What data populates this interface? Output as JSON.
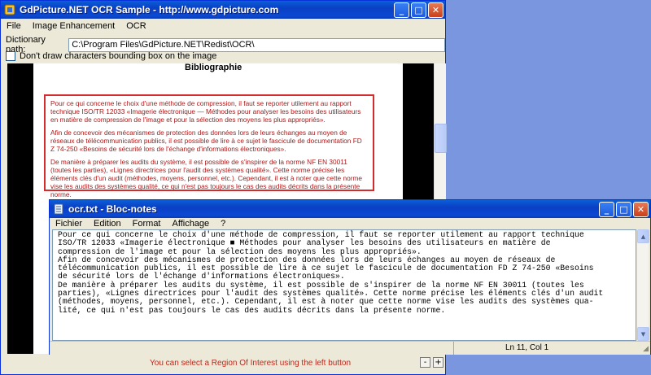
{
  "main_window": {
    "title": "GdPicture.NET OCR Sample  -  http://www.gdpicture.com",
    "menu": [
      "File",
      "Image Enhancement",
      "OCR"
    ],
    "dictionary_label": "Dictionary path:",
    "dictionary_value": "C:\\Program Files\\GdPicture.NET\\Redist\\OCR\\",
    "checkbox_label": "Don't draw characters bounding box on the image",
    "doc_heading": "Bibliographie",
    "doc_paragraphs": [
      "Pour ce qui concerne le choix d'une méthode de compression, il faut se reporter utilement au rapport technique ISO/TR 12033 «Imagerie électronique — Méthodes pour analyser les besoins des utilisateurs en matière de compression de l'image et pour la sélection des moyens les plus appropriés».",
      "Afin de concevoir des mécanismes de protection des données lors de leurs échanges au moyen de réseaux de télécommunication publics, il est possible de lire à ce sujet le fascicule de documentation FD Z 74-250 «Besoins de sécurité lors de l'échange d'informations électroniques».",
      "De manière à préparer les audits du système, il est possible de s'inspirer de la norme NF EN 30011 (toutes les parties), «Lignes directrices pour l'audit des systèmes qualité». Cette norme précise les éléments clés d'un audit (méthodes, moyens, personnel, etc.). Cependant, il est à noter que cette norme vise les audits des systèmes qualité, ce qui n'est pas toujours le cas des audits décrits dans la présente norme."
    ],
    "status_hint": "You can select a Region Of Interest using the left button",
    "zoom_out_label": "-",
    "zoom_in_label": "+",
    "title_buttons": {
      "minimize": "_",
      "maximize": "□",
      "close": "✕"
    }
  },
  "notepad": {
    "title": "ocr.txt - Bloc-notes",
    "menu": [
      "Fichier",
      "Edition",
      "Format",
      "Affichage",
      "?"
    ],
    "lines": [
      "Pour ce qui concerne le choix d'une méthode de compression, il faut se reporter utilement au rapport technique",
      "ISO/TR 12033 «Imagerie électronique ■ Méthodes pour analyser les besoins des utilisateurs en matière de",
      "compression de l'image et pour la sélection des moyens les plus appropriés».",
      "Afin de concevoir des mécanismes de protection des données lors de leurs échanges au moyen de réseaux de",
      "télécommunication publics, il est possible de lire à ce sujet le fascicule de documentation FD Z 74-250 «Besoins",
      "de sécurité lors de l'échange d'informations électroniques».",
      "De manière à préparer les audits du système, il est possible de s'inspirer de la norme NF EN 30011 (toutes les",
      "parties), «Lignes directrices pour l'audit des systèmes qualité». Cette norme précise les éléments clés d'un audit",
      "(méthodes, moyens, personnel, etc.). Cependant, il est à noter que cette norme vise les audits des systèmes qua-",
      "lité, ce qui n'est pas toujours le cas des audits décrits dans la présente norme."
    ],
    "status_position": "Ln 11, Col 1",
    "title_buttons": {
      "minimize": "_",
      "maximize": "□",
      "close": "✕"
    }
  },
  "colors": {
    "titlebar": "#0a4fd0",
    "highlight_box": "#d42c2c",
    "hint_text": "#c0281c"
  }
}
